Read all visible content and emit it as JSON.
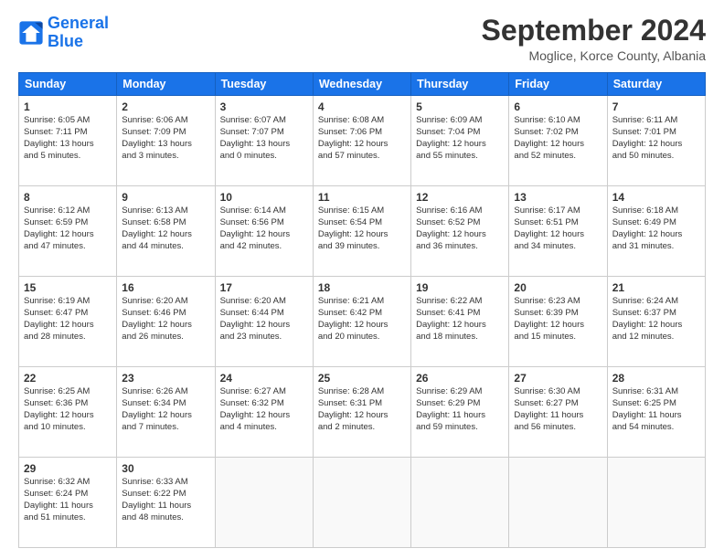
{
  "logo": {
    "line1": "General",
    "line2": "Blue"
  },
  "title": "September 2024",
  "location": "Moglice, Korce County, Albania",
  "days_header": [
    "Sunday",
    "Monday",
    "Tuesday",
    "Wednesday",
    "Thursday",
    "Friday",
    "Saturday"
  ],
  "weeks": [
    [
      {
        "day": "1",
        "lines": [
          "Sunrise: 6:05 AM",
          "Sunset: 7:11 PM",
          "Daylight: 13 hours",
          "and 5 minutes."
        ]
      },
      {
        "day": "2",
        "lines": [
          "Sunrise: 6:06 AM",
          "Sunset: 7:09 PM",
          "Daylight: 13 hours",
          "and 3 minutes."
        ]
      },
      {
        "day": "3",
        "lines": [
          "Sunrise: 6:07 AM",
          "Sunset: 7:07 PM",
          "Daylight: 13 hours",
          "and 0 minutes."
        ]
      },
      {
        "day": "4",
        "lines": [
          "Sunrise: 6:08 AM",
          "Sunset: 7:06 PM",
          "Daylight: 12 hours",
          "and 57 minutes."
        ]
      },
      {
        "day": "5",
        "lines": [
          "Sunrise: 6:09 AM",
          "Sunset: 7:04 PM",
          "Daylight: 12 hours",
          "and 55 minutes."
        ]
      },
      {
        "day": "6",
        "lines": [
          "Sunrise: 6:10 AM",
          "Sunset: 7:02 PM",
          "Daylight: 12 hours",
          "and 52 minutes."
        ]
      },
      {
        "day": "7",
        "lines": [
          "Sunrise: 6:11 AM",
          "Sunset: 7:01 PM",
          "Daylight: 12 hours",
          "and 50 minutes."
        ]
      }
    ],
    [
      {
        "day": "8",
        "lines": [
          "Sunrise: 6:12 AM",
          "Sunset: 6:59 PM",
          "Daylight: 12 hours",
          "and 47 minutes."
        ]
      },
      {
        "day": "9",
        "lines": [
          "Sunrise: 6:13 AM",
          "Sunset: 6:58 PM",
          "Daylight: 12 hours",
          "and 44 minutes."
        ]
      },
      {
        "day": "10",
        "lines": [
          "Sunrise: 6:14 AM",
          "Sunset: 6:56 PM",
          "Daylight: 12 hours",
          "and 42 minutes."
        ]
      },
      {
        "day": "11",
        "lines": [
          "Sunrise: 6:15 AM",
          "Sunset: 6:54 PM",
          "Daylight: 12 hours",
          "and 39 minutes."
        ]
      },
      {
        "day": "12",
        "lines": [
          "Sunrise: 6:16 AM",
          "Sunset: 6:52 PM",
          "Daylight: 12 hours",
          "and 36 minutes."
        ]
      },
      {
        "day": "13",
        "lines": [
          "Sunrise: 6:17 AM",
          "Sunset: 6:51 PM",
          "Daylight: 12 hours",
          "and 34 minutes."
        ]
      },
      {
        "day": "14",
        "lines": [
          "Sunrise: 6:18 AM",
          "Sunset: 6:49 PM",
          "Daylight: 12 hours",
          "and 31 minutes."
        ]
      }
    ],
    [
      {
        "day": "15",
        "lines": [
          "Sunrise: 6:19 AM",
          "Sunset: 6:47 PM",
          "Daylight: 12 hours",
          "and 28 minutes."
        ]
      },
      {
        "day": "16",
        "lines": [
          "Sunrise: 6:20 AM",
          "Sunset: 6:46 PM",
          "Daylight: 12 hours",
          "and 26 minutes."
        ]
      },
      {
        "day": "17",
        "lines": [
          "Sunrise: 6:20 AM",
          "Sunset: 6:44 PM",
          "Daylight: 12 hours",
          "and 23 minutes."
        ]
      },
      {
        "day": "18",
        "lines": [
          "Sunrise: 6:21 AM",
          "Sunset: 6:42 PM",
          "Daylight: 12 hours",
          "and 20 minutes."
        ]
      },
      {
        "day": "19",
        "lines": [
          "Sunrise: 6:22 AM",
          "Sunset: 6:41 PM",
          "Daylight: 12 hours",
          "and 18 minutes."
        ]
      },
      {
        "day": "20",
        "lines": [
          "Sunrise: 6:23 AM",
          "Sunset: 6:39 PM",
          "Daylight: 12 hours",
          "and 15 minutes."
        ]
      },
      {
        "day": "21",
        "lines": [
          "Sunrise: 6:24 AM",
          "Sunset: 6:37 PM",
          "Daylight: 12 hours",
          "and 12 minutes."
        ]
      }
    ],
    [
      {
        "day": "22",
        "lines": [
          "Sunrise: 6:25 AM",
          "Sunset: 6:36 PM",
          "Daylight: 12 hours",
          "and 10 minutes."
        ]
      },
      {
        "day": "23",
        "lines": [
          "Sunrise: 6:26 AM",
          "Sunset: 6:34 PM",
          "Daylight: 12 hours",
          "and 7 minutes."
        ]
      },
      {
        "day": "24",
        "lines": [
          "Sunrise: 6:27 AM",
          "Sunset: 6:32 PM",
          "Daylight: 12 hours",
          "and 4 minutes."
        ]
      },
      {
        "day": "25",
        "lines": [
          "Sunrise: 6:28 AM",
          "Sunset: 6:31 PM",
          "Daylight: 12 hours",
          "and 2 minutes."
        ]
      },
      {
        "day": "26",
        "lines": [
          "Sunrise: 6:29 AM",
          "Sunset: 6:29 PM",
          "Daylight: 11 hours",
          "and 59 minutes."
        ]
      },
      {
        "day": "27",
        "lines": [
          "Sunrise: 6:30 AM",
          "Sunset: 6:27 PM",
          "Daylight: 11 hours",
          "and 56 minutes."
        ]
      },
      {
        "day": "28",
        "lines": [
          "Sunrise: 6:31 AM",
          "Sunset: 6:25 PM",
          "Daylight: 11 hours",
          "and 54 minutes."
        ]
      }
    ],
    [
      {
        "day": "29",
        "lines": [
          "Sunrise: 6:32 AM",
          "Sunset: 6:24 PM",
          "Daylight: 11 hours",
          "and 51 minutes."
        ]
      },
      {
        "day": "30",
        "lines": [
          "Sunrise: 6:33 AM",
          "Sunset: 6:22 PM",
          "Daylight: 11 hours",
          "and 48 minutes."
        ]
      },
      {
        "day": "",
        "lines": []
      },
      {
        "day": "",
        "lines": []
      },
      {
        "day": "",
        "lines": []
      },
      {
        "day": "",
        "lines": []
      },
      {
        "day": "",
        "lines": []
      }
    ]
  ]
}
